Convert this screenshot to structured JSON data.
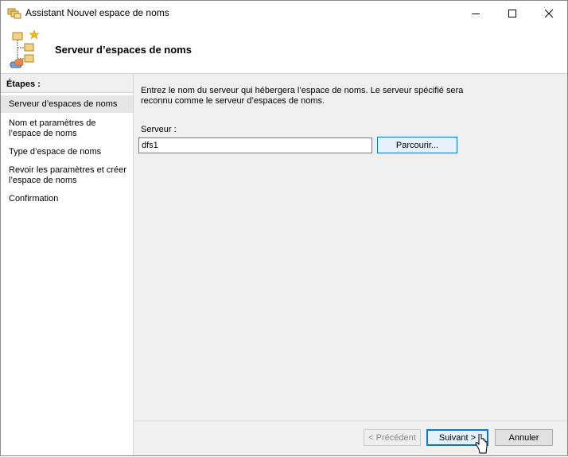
{
  "window": {
    "title": "Assistant Nouvel espace de noms",
    "icon": "namespace-wizard-icon"
  },
  "header": {
    "title": "Serveur d’espaces de noms",
    "icon": "namespace-tree-icon"
  },
  "steps": {
    "heading": "Étapes :",
    "items": [
      {
        "label": "Serveur d’espaces de noms",
        "selected": true
      },
      {
        "label": "Nom et paramètres de l’espace de noms",
        "selected": false
      },
      {
        "label": "Type d’espace de noms",
        "selected": false
      },
      {
        "label": "Revoir les paramètres et créer l’espace de noms",
        "selected": false
      },
      {
        "label": "Confirmation",
        "selected": false
      }
    ]
  },
  "main": {
    "description": "Entrez le nom du serveur qui hébergera l’espace de noms. Le serveur spécifié sera reconnu comme le serveur d’espaces de noms.",
    "server_label": "Serveur :",
    "server_value": "dfs1",
    "browse_label": "Parcourir..."
  },
  "footer": {
    "prev_label": "< Précédent",
    "next_label": "Suivant >",
    "cancel_label": "Annuler"
  },
  "colors": {
    "accent": "#0078d7",
    "window_bg": "#f0f0f0",
    "selected_step": "#e6e6e6"
  }
}
